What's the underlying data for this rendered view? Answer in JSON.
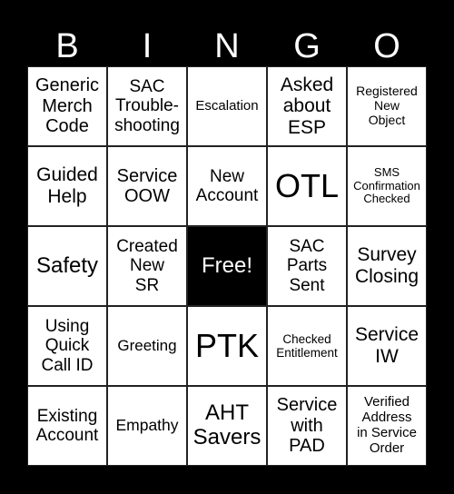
{
  "header": [
    "B",
    "I",
    "N",
    "G",
    "O"
  ],
  "cells": [
    "Generic\nMerch\nCode",
    "SAC\nTrouble-\nshooting",
    "Escalation",
    "Asked\nabout\nESP",
    "Registered\nNew\nObject",
    "Guided\nHelp",
    "Service\nOOW",
    "New\nAccount",
    "OTL",
    "SMS\nConfirmation\nChecked",
    "Safety",
    "Created\nNew\nSR",
    "Free!",
    "SAC\nParts\nSent",
    "Survey\nClosing",
    "Using\nQuick\nCall ID",
    "Greeting",
    "PTK",
    "Checked\nEntitlement",
    "Service\nIW",
    "Existing\nAccount",
    "Empathy",
    "AHT\nSavers",
    "Service\nwith\nPAD",
    "Verified\nAddress\nin Service\nOrder"
  ],
  "colors": {
    "background": "#000000",
    "cell": "#ffffff",
    "free_cell": "#000000"
  }
}
